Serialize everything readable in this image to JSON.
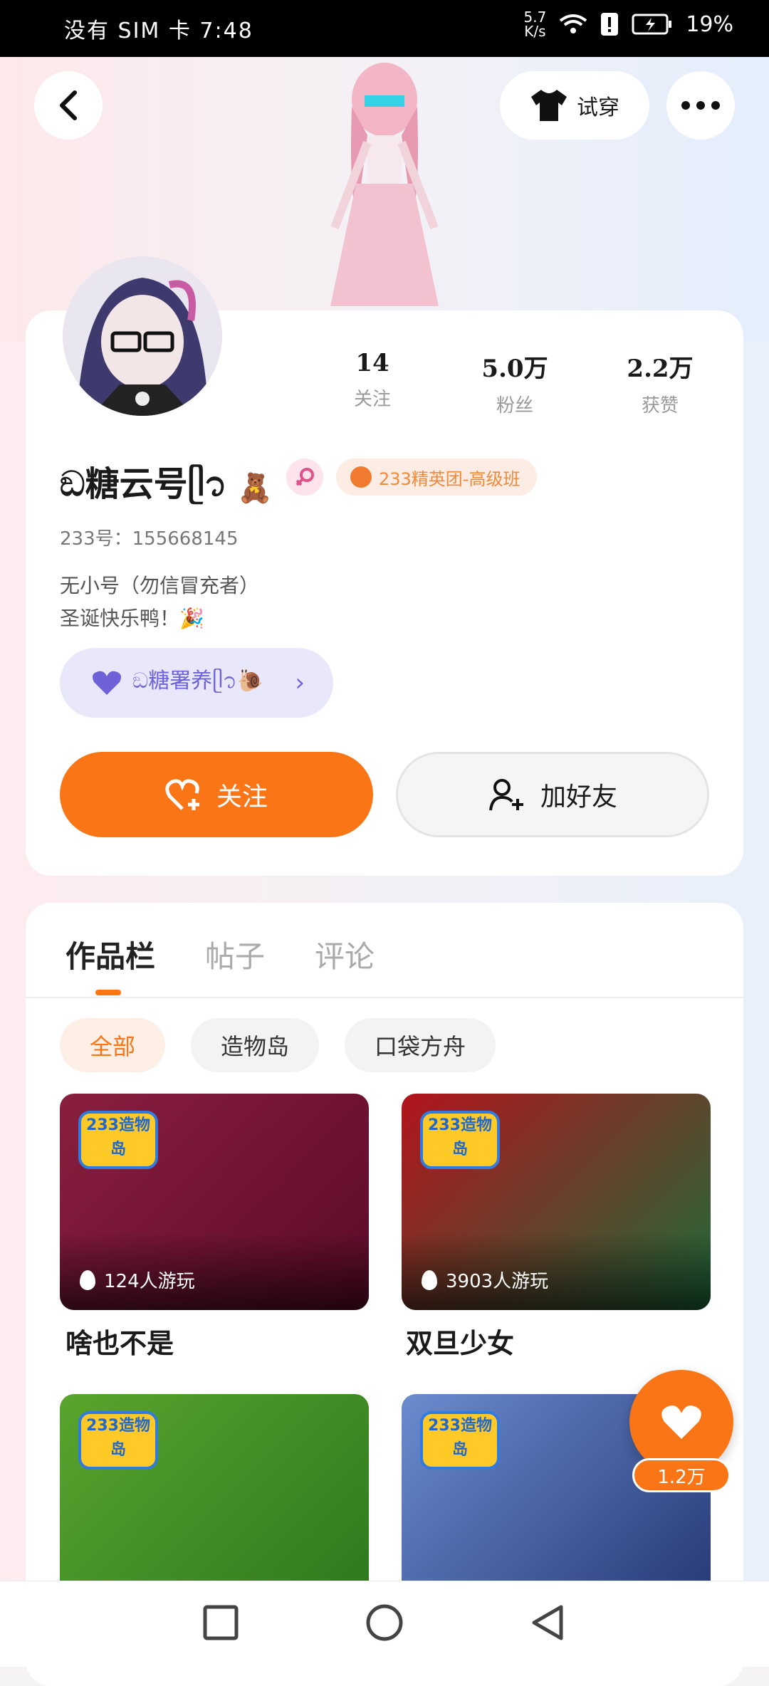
{
  "status_bar": {
    "carrier": "没有 SIM 卡",
    "time": "7:48",
    "speed": "5.7",
    "speed_unit": "K/s",
    "battery": "19%"
  },
  "header": {
    "try_on_label": "试穿"
  },
  "profile": {
    "name": "ඞ糖云号ᥫ᭡",
    "rank_badge": "233精英团-高级班",
    "uid": "233号：155668145",
    "bio_line1": "无小号（勿信冒充者）",
    "bio_line2": "圣诞快乐鸭！🎉",
    "group_label": "ඞ糖署养ᥫ᭡🐌",
    "stats": [
      {
        "value": "14",
        "label": "关注"
      },
      {
        "value": "5.0万",
        "label": "粉丝"
      },
      {
        "value": "2.2万",
        "label": "获赞"
      }
    ],
    "follow_label": "关注",
    "add_friend_label": "加好友"
  },
  "tabs": [
    "作品栏",
    "帖子",
    "评论"
  ],
  "chips": [
    "全部",
    "造物岛",
    "口袋方舟"
  ],
  "works": [
    {
      "logo": "233造物岛",
      "plays": "124人游玩",
      "title": "啥也不是",
      "colors": [
        "#8a1f3f",
        "#5c0a2a"
      ]
    },
    {
      "logo": "233造物岛",
      "plays": "3903人游玩",
      "title": "双旦少女",
      "colors": [
        "#b3141c",
        "#1e6b3a"
      ]
    },
    {
      "logo": "233造物岛",
      "plays": "",
      "title": "",
      "colors": [
        "#5aa52e",
        "#2f7a1e"
      ]
    },
    {
      "logo": "233造物岛",
      "plays": "",
      "title": "",
      "colors": [
        "#6a8ccf",
        "#2a3c7a"
      ]
    }
  ],
  "like_count": "1.2万",
  "icons": [
    "back-icon",
    "tshirt-icon",
    "more-icon",
    "female-icon",
    "heart-icon",
    "add-user-icon",
    "flame-icon",
    "square-icon",
    "circle-icon",
    "triangle-back-icon"
  ]
}
